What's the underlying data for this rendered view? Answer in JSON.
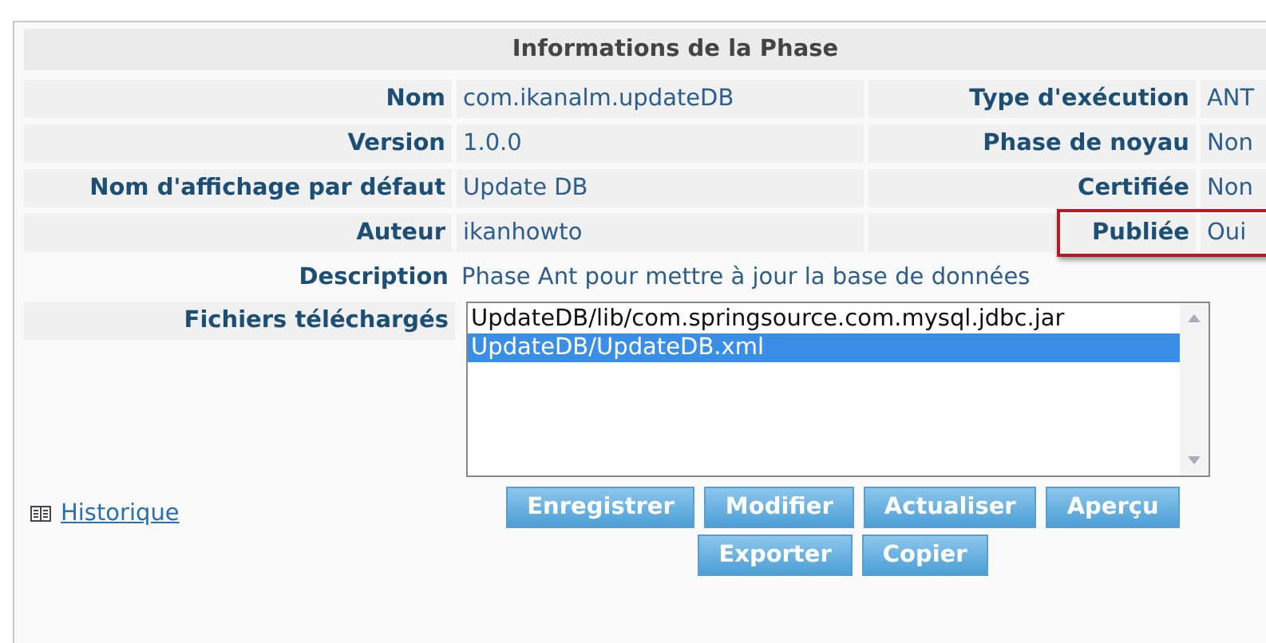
{
  "panel": {
    "title": "Informations de la Phase"
  },
  "pairs": [
    {
      "left": {
        "label": "Nom",
        "value": "com.ikanalm.updateDB"
      },
      "right": {
        "label": "Type d'exécution",
        "value": "ANT",
        "highlighted": false
      }
    },
    {
      "left": {
        "label": "Version",
        "value": "1.0.0"
      },
      "right": {
        "label": "Phase de noyau",
        "value": "Non",
        "highlighted": false
      }
    },
    {
      "left": {
        "label": "Nom d'affichage par défaut",
        "value": "Update DB"
      },
      "right": {
        "label": "Certifiée",
        "value": "Non",
        "highlighted": false
      }
    },
    {
      "left": {
        "label": "Auteur",
        "value": "ikanhowto"
      },
      "right": {
        "label": "Publiée",
        "value": "Oui",
        "highlighted": true
      }
    }
  ],
  "description": {
    "label": "Description",
    "value": "Phase Ant pour mettre à jour la base de données"
  },
  "files": {
    "label": "Fichiers téléchargés",
    "items": [
      {
        "name": "UpdateDB/lib/com.springsource.com.mysql.jdbc.jar",
        "selected": false
      },
      {
        "name": "UpdateDB/UpdateDB.xml",
        "selected": true
      }
    ]
  },
  "history_link": "Historique",
  "button_rows": [
    [
      "Enregistrer",
      "Modifier",
      "Actualiser",
      "Aperçu"
    ],
    [
      "Exporter",
      "Copier"
    ]
  ]
}
